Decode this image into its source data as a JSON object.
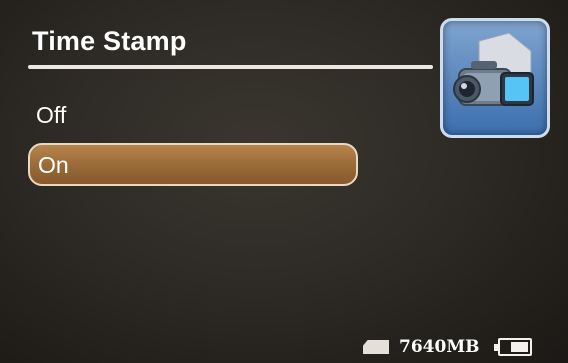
{
  "header": {
    "title": "Time Stamp"
  },
  "mode_icon": {
    "name": "video-camera-icon"
  },
  "menu": {
    "items": [
      {
        "label": "Off",
        "selected": false
      },
      {
        "label": "On",
        "selected": true
      }
    ]
  },
  "status": {
    "storage_icon": "sd-card-icon",
    "storage_label": "7640MB",
    "battery_icon": "battery-icon",
    "battery_level": 0.67
  },
  "colors": {
    "selection": "#a6763f",
    "selection_border": "#e7d8c4",
    "icon_background": "#5a88c0",
    "text": "#ffffff"
  }
}
